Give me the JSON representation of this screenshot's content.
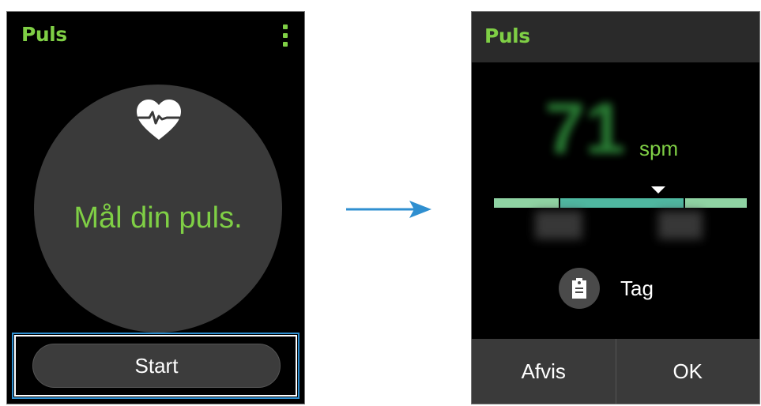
{
  "left_screen": {
    "title": "Puls",
    "more_icon": "vertical-ellipsis",
    "heart_icon": "heart-pulse",
    "prompt": "Mål din puls.",
    "start_label": "Start"
  },
  "arrow_icon": "right-arrow",
  "right_screen": {
    "title": "Puls",
    "bpm_value": "71",
    "bpm_unit": "spm",
    "tag_icon": "tag-clipboard",
    "tag_label": "Tag",
    "dismiss_label": "Afvis",
    "ok_label": "OK"
  },
  "colors": {
    "accent_green": "#7fcf45",
    "highlight_frame": "#2f8fd0",
    "arrow_blue": "#2f8fd0"
  }
}
